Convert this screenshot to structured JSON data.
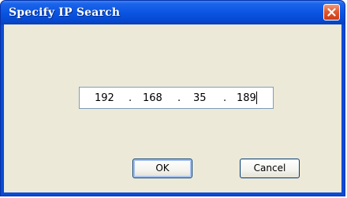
{
  "dialog": {
    "title": "Specify IP Search",
    "ip": {
      "octet1": "192",
      "octet2": "168",
      "octet3": "35",
      "octet4": "189",
      "separator": "."
    },
    "buttons": {
      "ok_label": "OK",
      "cancel_label": "Cancel"
    },
    "icons": {
      "close": "close-icon"
    }
  }
}
